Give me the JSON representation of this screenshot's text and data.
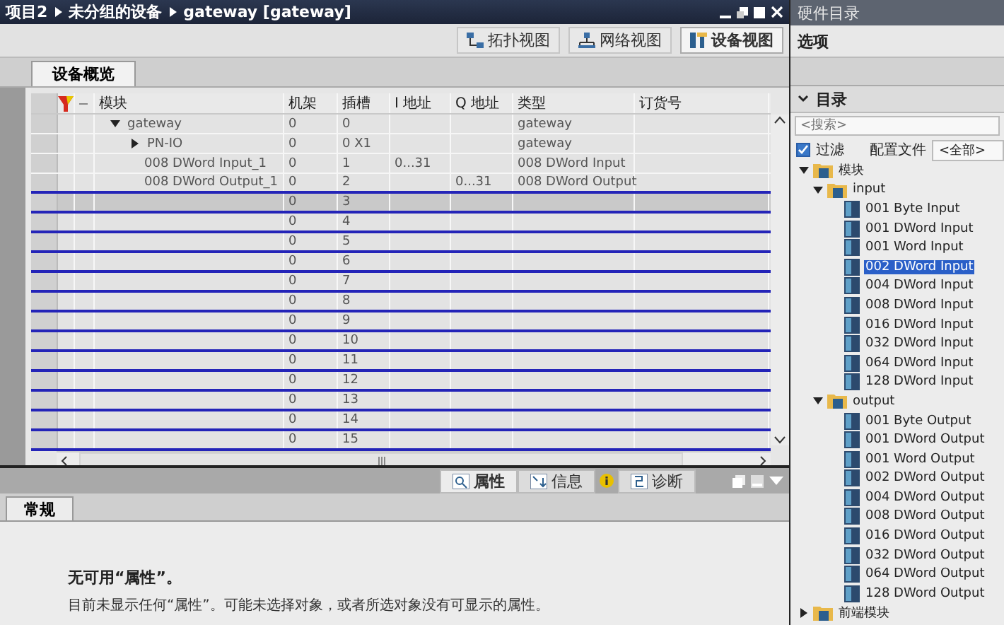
{
  "editor": {
    "breadcrumb": [
      "项目2",
      "未分组的设备",
      "gateway [gateway]"
    ],
    "view_tabs": [
      {
        "label": "拓扑视图",
        "selected": false
      },
      {
        "label": "网络视图",
        "selected": false
      },
      {
        "label": "设备视图",
        "selected": true
      }
    ],
    "overview_tab": {
      "label": "设备概览",
      "selected": true
    },
    "table": {
      "columns": [
        "模块",
        "机架",
        "插槽",
        "I 地址",
        "Q 地址",
        "类型",
        "订货号"
      ],
      "rows": [
        {
          "module": "gateway",
          "rack": "0",
          "slot": "0",
          "type": "gateway",
          "expanded": true,
          "selected": false,
          "children": [
            {
              "module": "PN-IO",
              "rack": "0",
              "slot": "0 X1",
              "type": "gateway",
              "expanded": false,
              "selected": false
            },
            {
              "module": "008 DWord Input_1",
              "rack": "0",
              "slot": "1",
              "i_address": "0...31",
              "type": "008 DWord Input",
              "selected": false
            },
            {
              "module": "008 DWord Output_1",
              "rack": "0",
              "slot": "2",
              "q_address": "0...31",
              "type": "008 DWord Output",
              "selected": false
            }
          ]
        },
        {
          "rack": "0",
          "slot": "3",
          "selected": true
        },
        {
          "rack": "0",
          "slot": "4",
          "selected": false
        },
        {
          "rack": "0",
          "slot": "5",
          "selected": false
        },
        {
          "rack": "0",
          "slot": "6",
          "selected": false
        },
        {
          "rack": "0",
          "slot": "7",
          "selected": false
        },
        {
          "rack": "0",
          "slot": "8",
          "selected": false
        },
        {
          "rack": "0",
          "slot": "9",
          "selected": false
        },
        {
          "rack": "0",
          "slot": "10",
          "selected": false
        },
        {
          "rack": "0",
          "slot": "11",
          "selected": false
        },
        {
          "rack": "0",
          "slot": "12",
          "selected": false
        },
        {
          "rack": "0",
          "slot": "13",
          "selected": false
        },
        {
          "rack": "0",
          "slot": "14",
          "selected": false
        },
        {
          "rack": "0",
          "slot": "15",
          "selected": false
        }
      ]
    }
  },
  "inspector": {
    "tabs": [
      {
        "label": "属性",
        "kind": "properties",
        "selected": true
      },
      {
        "label": "信息",
        "kind": "info",
        "selected": false
      },
      {
        "label": "诊断",
        "kind": "diagnostics",
        "selected": false
      }
    ],
    "sub_tab": {
      "label": "常规",
      "selected": true
    },
    "heading": "无可用“属性”。",
    "message": "目前未显示任何“属性”。可能未选择对象，或者所选对象没有可显示的属性。"
  },
  "hardware_catalog": {
    "title": "硬件目录",
    "options_label": "选项",
    "catalog_label": "目录",
    "search": {
      "placeholder": "<搜索>"
    },
    "filter": {
      "label": "过滤",
      "checked": true
    },
    "profile": {
      "label": "配置文件",
      "value": "<全部>"
    },
    "tree": [
      {
        "label": "模块",
        "kind": "folder",
        "expanded": true,
        "selected": false,
        "children": [
          {
            "label": "input",
            "kind": "folder",
            "expanded": true,
            "selected": false,
            "children": [
              {
                "label": "001 Byte Input",
                "kind": "module",
                "selected": false
              },
              {
                "label": "001 DWord Input",
                "kind": "module",
                "selected": false
              },
              {
                "label": "001 Word Input",
                "kind": "module",
                "selected": false
              },
              {
                "label": "002 DWord Input",
                "kind": "module",
                "selected": true
              },
              {
                "label": "004 DWord Input",
                "kind": "module",
                "selected": false
              },
              {
                "label": "008 DWord Input",
                "kind": "module",
                "selected": false
              },
              {
                "label": "016 DWord Input",
                "kind": "module",
                "selected": false
              },
              {
                "label": "032 DWord Input",
                "kind": "module",
                "selected": false
              },
              {
                "label": "064 DWord Input",
                "kind": "module",
                "selected": false
              },
              {
                "label": "128 DWord Input",
                "kind": "module",
                "selected": false
              }
            ]
          },
          {
            "label": "output",
            "kind": "folder",
            "expanded": true,
            "selected": false,
            "children": [
              {
                "label": "001 Byte Output",
                "kind": "module",
                "selected": false
              },
              {
                "label": "001 DWord Output",
                "kind": "module",
                "selected": false
              },
              {
                "label": "001 Word Output",
                "kind": "module",
                "selected": false
              },
              {
                "label": "002 DWord Output",
                "kind": "module",
                "selected": false
              },
              {
                "label": "004 DWord Output",
                "kind": "module",
                "selected": false
              },
              {
                "label": "008 DWord Output",
                "kind": "module",
                "selected": false
              },
              {
                "label": "016 DWord Output",
                "kind": "module",
                "selected": false
              },
              {
                "label": "032 DWord Output",
                "kind": "module",
                "selected": false
              },
              {
                "label": "064 DWord Output",
                "kind": "module",
                "selected": false
              },
              {
                "label": "128 DWord Output",
                "kind": "module",
                "selected": false
              }
            ]
          }
        ]
      },
      {
        "label": "前端模块",
        "kind": "folder",
        "expanded": false,
        "selected": false
      }
    ]
  }
}
